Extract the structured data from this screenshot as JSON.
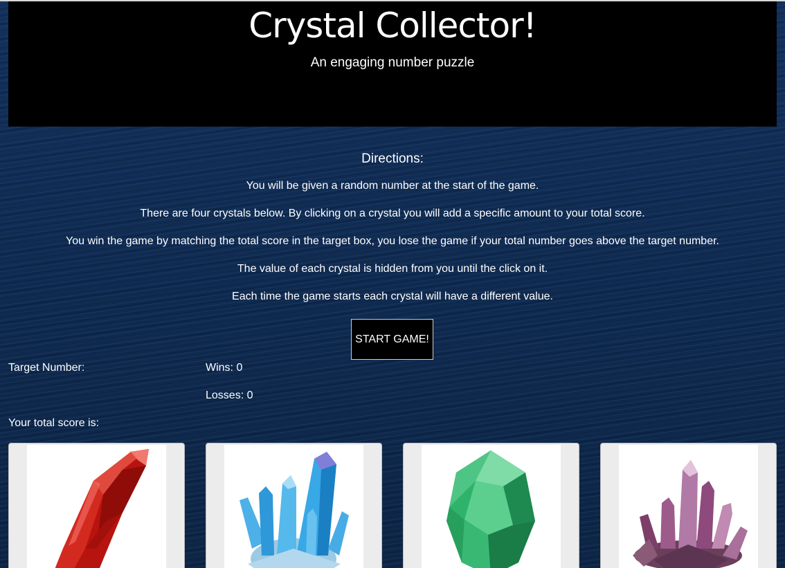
{
  "header": {
    "title": "Crystal Collector!",
    "subtitle": "An engaging number puzzle"
  },
  "directions": {
    "heading": "Directions:",
    "lines": [
      "You will be given a random number at the start of the game.",
      "There are four crystals below. By clicking on a crystal you will add a specific amount to your total score.",
      "You win the game by matching the total score in the target box, you lose the game if your total number goes above the target number.",
      "The value of each crystal is hidden from you until the click on it.",
      "Each time the game starts each crystal will have a different value."
    ]
  },
  "start_button": {
    "label": "START GAME!"
  },
  "stats": {
    "target_label": "Target Number:",
    "wins_label": "Wins: 0",
    "losses_label": "Losses: 0",
    "total_label": "Your total score is:"
  },
  "crystals": [
    {
      "color": "#c8201a",
      "icon": "red-crystal"
    },
    {
      "color": "#3fa9e0",
      "icon": "blue-crystal-cluster"
    },
    {
      "color": "#2fb36a",
      "icon": "green-crystal"
    },
    {
      "color": "#9a4f86",
      "icon": "purple-crystal-cluster"
    }
  ],
  "colors": {
    "background": "#0e2a52",
    "header_bg": "#000000",
    "text": "#ffffff"
  }
}
